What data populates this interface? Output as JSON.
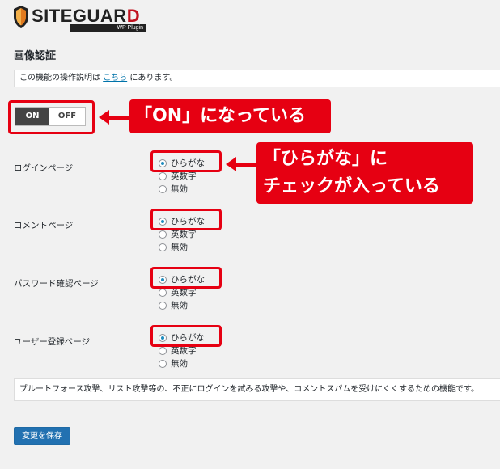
{
  "logo": {
    "brand_main": "SITEGUAR",
    "brand_accent": "D",
    "tagline": "WP Plugin"
  },
  "page_title": "画像認証",
  "notice": {
    "prefix": "この機能の操作説明は ",
    "link": "こちら",
    "suffix": " にあります。"
  },
  "toggle": {
    "on_label": "ON",
    "off_label": "OFF",
    "state": "ON"
  },
  "sections": [
    {
      "label": "ログインページ",
      "options": [
        "ひらがな",
        "英数字",
        "無効"
      ],
      "selected": "ひらがな"
    },
    {
      "label": "コメントページ",
      "options": [
        "ひらがな",
        "英数字",
        "無効"
      ],
      "selected": "ひらがな"
    },
    {
      "label": "パスワード確認ページ",
      "options": [
        "ひらがな",
        "英数字",
        "無効"
      ],
      "selected": "ひらがな"
    },
    {
      "label": "ユーザー登録ページ",
      "options": [
        "ひらがな",
        "英数字",
        "無効"
      ],
      "selected": "ひらがな"
    }
  ],
  "description": "ブルートフォース攻撃、リスト攻撃等の、不正にログインを試みる攻撃や、コメントスパムを受けにくくするための機能です。",
  "save_button": "変更を保存",
  "annotations": {
    "on_callout": "「ON」になっている",
    "hiragana_callout_line1": "「ひらがな」に",
    "hiragana_callout_line2": "チェックが入っている",
    "color": "#e60012"
  }
}
